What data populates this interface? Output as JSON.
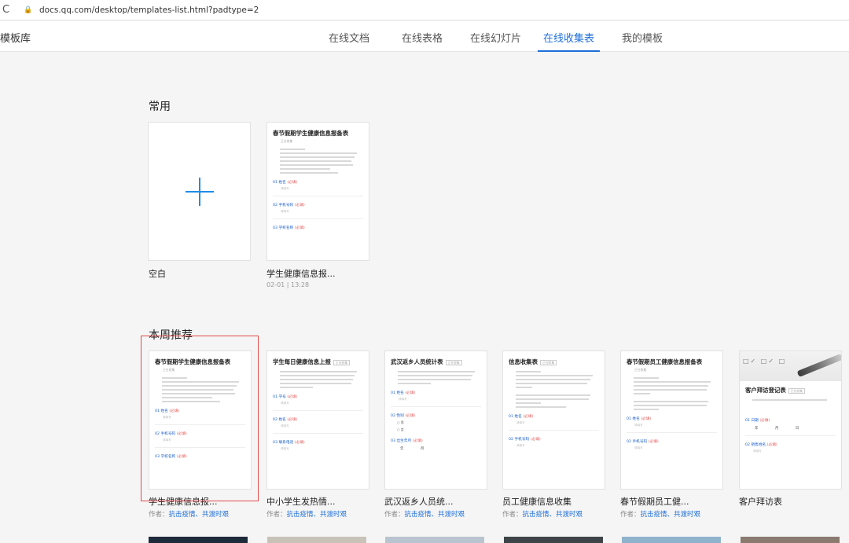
{
  "browser": {
    "url": "docs.qq.com/desktop/templates-list.html?padtype=2"
  },
  "header": {
    "brand": "模板库",
    "tabs": [
      {
        "label": "在线文档",
        "active": false
      },
      {
        "label": "在线表格",
        "active": false
      },
      {
        "label": "在线幻灯片",
        "active": false
      },
      {
        "label": "在线收集表",
        "active": true
      },
      {
        "label": "我的模板",
        "active": false
      }
    ]
  },
  "common": {
    "title": "常用",
    "blank_label": "空白",
    "recent": {
      "preview_title": "春节假期学生健康信息报备表",
      "preview_tag": "正在收集",
      "q1": "01 姓名",
      "q2": "02 手机号码",
      "q3": "03 学校名称",
      "required": "(必填)",
      "placeholder": "请填写",
      "name": "学生健康信息报...",
      "date": "02-01 | 13:28"
    }
  },
  "weekly": {
    "title": "本周推荐",
    "author_prefix": "作者：",
    "author_name": "抗击疫情、共渡时艰",
    "cards": [
      {
        "preview_title": "春节假期学生健康信息报备表",
        "preview_tag": "正在收集",
        "q1": "01 姓名",
        "q2": "02 手机号码",
        "q3": "03 学校名称",
        "name": "学生健康信息报..."
      },
      {
        "preview_title": "学生每日健康信息上报",
        "preview_tag": "正在收集",
        "q1": "01 学号",
        "q2": "02 姓名",
        "q3": "03 联系电话",
        "name": "中小学生发热情..."
      },
      {
        "preview_title": "武汉返乡人员统计表",
        "preview_tag": "正在收集",
        "q1": "01 姓名",
        "q2": "02 性别",
        "q3": "03 出生年月",
        "opt1": "男",
        "opt2": "女",
        "date_row": "年 月",
        "name": "武汉返乡人员统..."
      },
      {
        "preview_title": "信息收集表",
        "preview_tag": "正在收集",
        "q1": "01 姓名",
        "q2": "02 手机号码",
        "name": "员工健康信息收集"
      },
      {
        "preview_title": "春节假期员工健康信息报备表",
        "preview_tag": "正在收集",
        "q1": "01 姓名",
        "q2": "02 手机号码",
        "name": "春节假期员工健..."
      },
      {
        "preview_title": "客户拜访登记表",
        "preview_tag": "正在收集",
        "q1": "01 日期",
        "q2": "02 销售姓名",
        "date_row": "年 月 日",
        "name": "客户拜访表"
      }
    ],
    "required": "(必填)",
    "placeholder": "请填写"
  }
}
